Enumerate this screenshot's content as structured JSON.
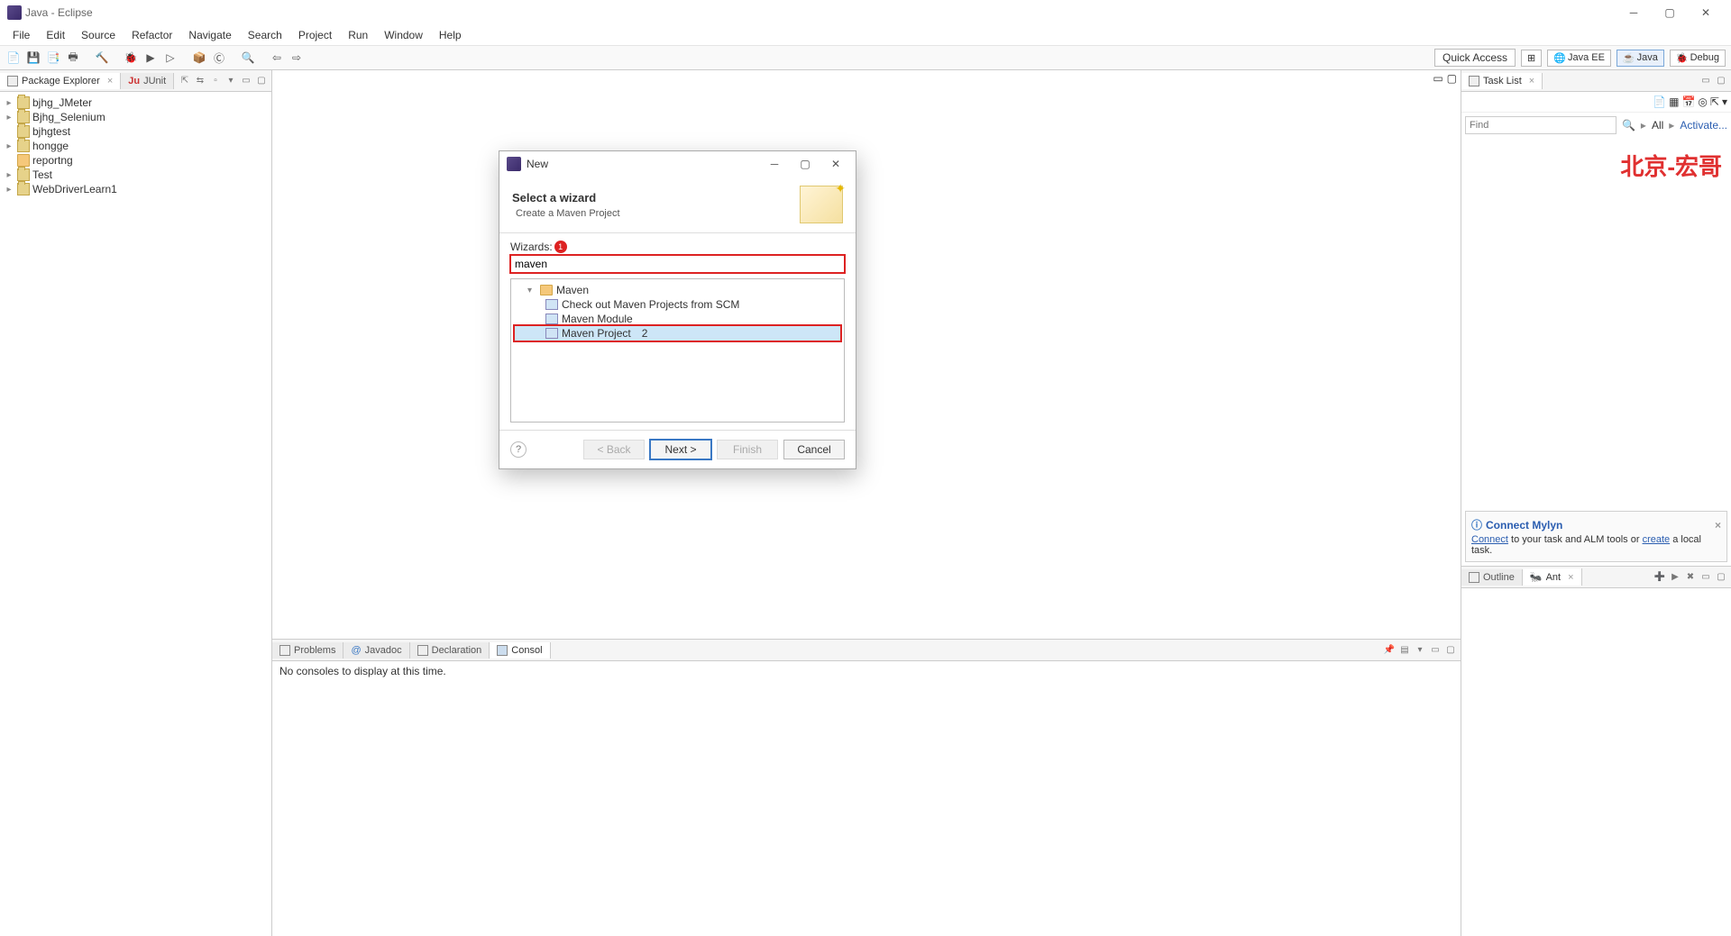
{
  "window": {
    "title": "Java - Eclipse"
  },
  "menu": {
    "items": [
      "File",
      "Edit",
      "Source",
      "Refactor",
      "Navigate",
      "Search",
      "Project",
      "Run",
      "Window",
      "Help"
    ]
  },
  "toolbar": {
    "quick_access": "Quick Access"
  },
  "perspectives": {
    "java_ee": "Java EE",
    "java": "Java",
    "debug": "Debug"
  },
  "package_explorer": {
    "tab": "Package Explorer",
    "junit_tab": "JUnit",
    "projects": [
      {
        "name": "bjhg_JMeter",
        "expandable": true
      },
      {
        "name": "Bjhg_Selenium",
        "expandable": true
      },
      {
        "name": "bjhgtest",
        "expandable": false
      },
      {
        "name": "hongge",
        "expandable": true
      },
      {
        "name": "reportng",
        "expandable": false
      },
      {
        "name": "Test",
        "expandable": true
      },
      {
        "name": "WebDriverLearn1",
        "expandable": true
      }
    ]
  },
  "bottom_tabs": {
    "problems": "Problems",
    "javadoc": "Javadoc",
    "declaration": "Declaration",
    "console": "Consol"
  },
  "console": {
    "text": "No consoles to display at this time."
  },
  "task_list": {
    "tab": "Task List",
    "find_placeholder": "Find",
    "all": "All",
    "activate": "Activate..."
  },
  "watermark": "北京-宏哥",
  "mylyn": {
    "title": "Connect Mylyn",
    "connect": "Connect",
    "desc_mid": " to your task and ALM tools or ",
    "create": "create",
    "desc_end": " a local task."
  },
  "outline": {
    "tab": "Outline",
    "ant_tab": "Ant"
  },
  "dialog": {
    "title": "New",
    "heading": "Select a wizard",
    "subheading": "Create a Maven Project",
    "wizards_label": "Wizards:",
    "filter": "maven",
    "annot1": "1",
    "annot2": "2",
    "tree": {
      "folder": "Maven",
      "items": [
        "Check out Maven Projects from SCM",
        "Maven Module",
        "Maven Project"
      ]
    },
    "buttons": {
      "back": "< Back",
      "next": "Next >",
      "finish": "Finish",
      "cancel": "Cancel"
    }
  }
}
